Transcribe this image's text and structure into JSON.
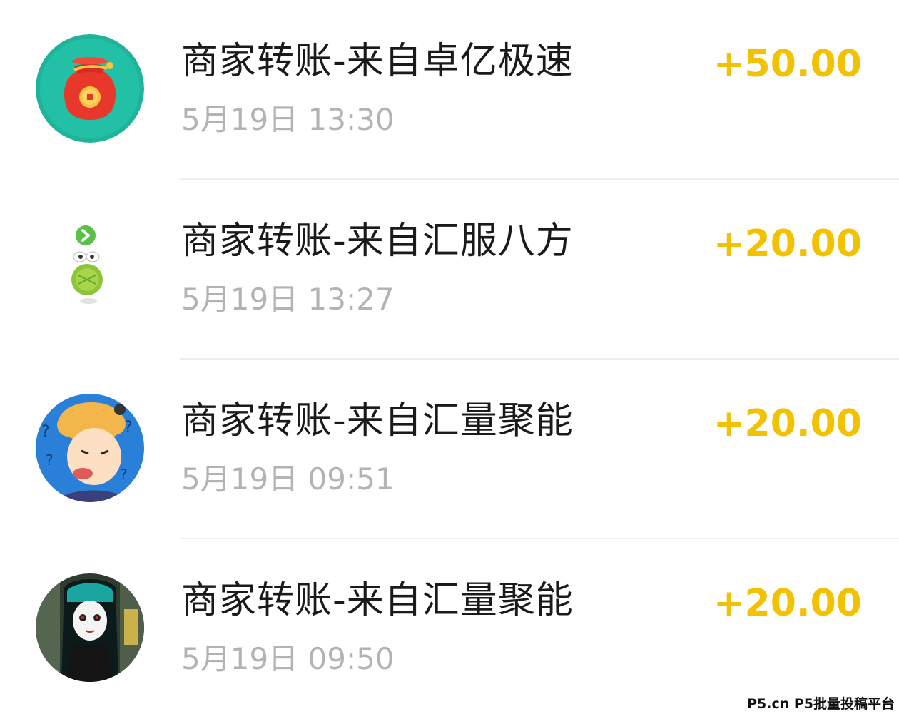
{
  "transactions": [
    {
      "title": "商家转账-来自卓亿极速",
      "time": "5月19日 13:30",
      "amount": "+50.00",
      "avatar_icon": "red-money-bag-icon"
    },
    {
      "title": "商家转账-来自汇服八方",
      "time": "5月19日 13:27",
      "amount": "+20.00",
      "avatar_icon": "green-frog-icon"
    },
    {
      "title": "商家转账-来自汇量聚能",
      "time": "5月19日 09:51",
      "amount": "+20.00",
      "avatar_icon": "cartoon-face-avatar"
    },
    {
      "title": "商家转账-来自汇量聚能",
      "time": "5月19日 09:50",
      "amount": "+20.00",
      "avatar_icon": "dark-cartoon-girl-avatar"
    }
  ],
  "watermark": "P5.cn P5批量投稿平台",
  "colors": {
    "amount": "#f2c200",
    "title": "#1a1a1a",
    "time": "#b3b3b3",
    "divider": "#eeeeee"
  }
}
